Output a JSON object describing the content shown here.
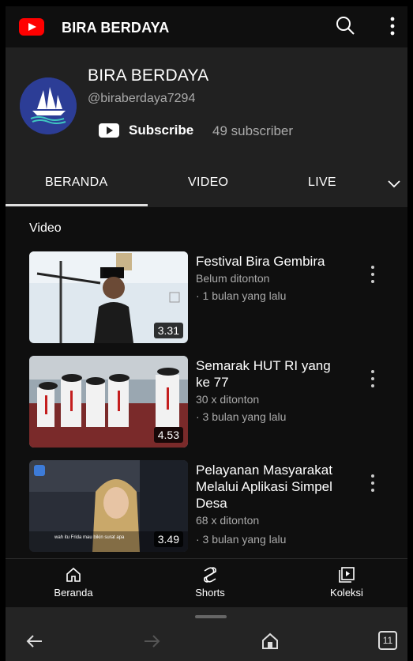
{
  "header": {
    "title": "BIRA BERDAYA",
    "logo_icon": "youtube-logo-icon",
    "search_icon": "search-icon",
    "more_icon": "more-vertical-icon"
  },
  "channel": {
    "name": "BIRA BERDAYA",
    "handle": "@biraberdaya7294",
    "avatar_text": "BIRA BERDAYA",
    "subscribe_label": "Subscribe",
    "subscriber_count": "49 subscriber"
  },
  "tabs": {
    "items": [
      {
        "label": "BERANDA"
      },
      {
        "label": "VIDEO"
      },
      {
        "label": "LIVE"
      }
    ],
    "active": "BERANDA"
  },
  "section": {
    "title": "Video"
  },
  "videos": [
    {
      "title": "Festival Bira Gembira",
      "views": "Belum ditonton",
      "age": "· 1 bulan yang lalu",
      "duration": "3.31"
    },
    {
      "title": "Semarak HUT RI yang ke 77",
      "views": "30 x ditonton",
      "age": "· 3 bulan yang lalu",
      "duration": "4.53"
    },
    {
      "title": "Pelayanan Masyarakat Melalui Aplikasi Simpel Desa",
      "views": "68 x ditonton",
      "age": "· 3 bulan yang lalu",
      "duration": "3.49",
      "thumb_caption": "wah itu Frida mau bikin surat apa"
    }
  ],
  "bottom_nav": {
    "items": [
      {
        "label": "Beranda",
        "icon": "home-icon"
      },
      {
        "label": "Shorts",
        "icon": "shorts-icon"
      },
      {
        "label": "Koleksi",
        "icon": "library-icon"
      }
    ]
  },
  "system_bar": {
    "tab_count": "11"
  },
  "colors": {
    "brand_red": "#ff0000",
    "background": "#0f0f0f",
    "header_bg": "#212121",
    "secondary_text": "#aaaaaa"
  }
}
